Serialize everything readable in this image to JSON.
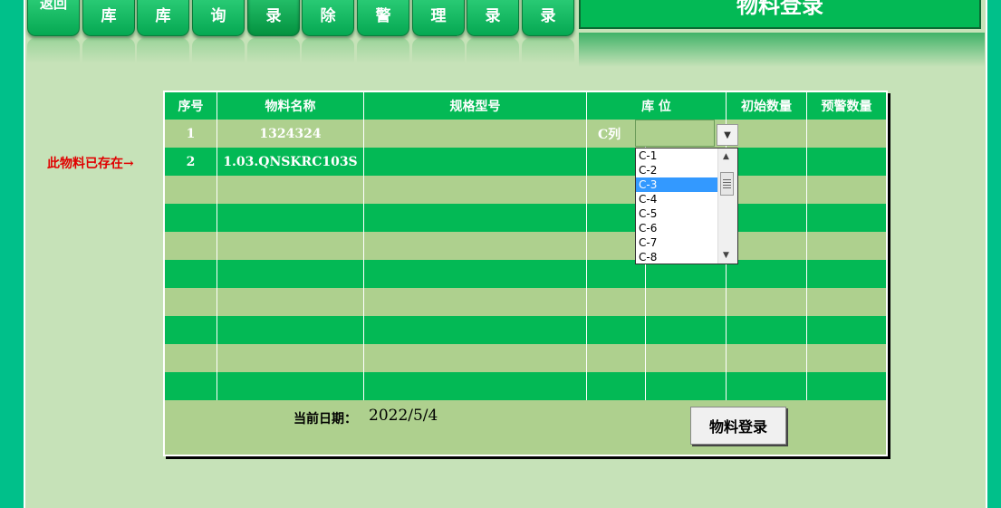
{
  "nav": {
    "tabs": [
      {
        "label": "返回",
        "sub": "回"
      },
      {
        "label": "库"
      },
      {
        "label": "库"
      },
      {
        "label": "询"
      },
      {
        "label": "录"
      },
      {
        "label": "除"
      },
      {
        "label": "警"
      },
      {
        "label": "理"
      },
      {
        "label": "录"
      },
      {
        "label": "录"
      }
    ],
    "active_index": 4
  },
  "title": "物料登录",
  "note": "此物料已存在→",
  "table": {
    "headers": [
      "序号",
      "物料名称",
      "规格型号",
      "库 位",
      "初始数量",
      "预警数量"
    ],
    "rows": [
      {
        "seq": "1",
        "name": "1324324",
        "spec": "",
        "loc": "C列",
        "init": "",
        "warn": ""
      },
      {
        "seq": "2",
        "name": "1.03.QNSKRC103S",
        "spec": "",
        "loc": "",
        "init": "",
        "warn": ""
      }
    ]
  },
  "footer": {
    "date_label": "当前日期：",
    "date_value": "2022/5/4",
    "submit_label": "物料登录"
  },
  "dropdown": {
    "options": [
      "C-1",
      "C-2",
      "C-3",
      "C-4",
      "C-5",
      "C-6",
      "C-7",
      "C-8"
    ],
    "selected": "C-3"
  },
  "colors": {
    "outer": "#00c08a",
    "sheet": "#c6e2b8",
    "green": "#03b955",
    "light_row": "#aed08e",
    "note": "#e00000",
    "selection": "#3399ff"
  }
}
